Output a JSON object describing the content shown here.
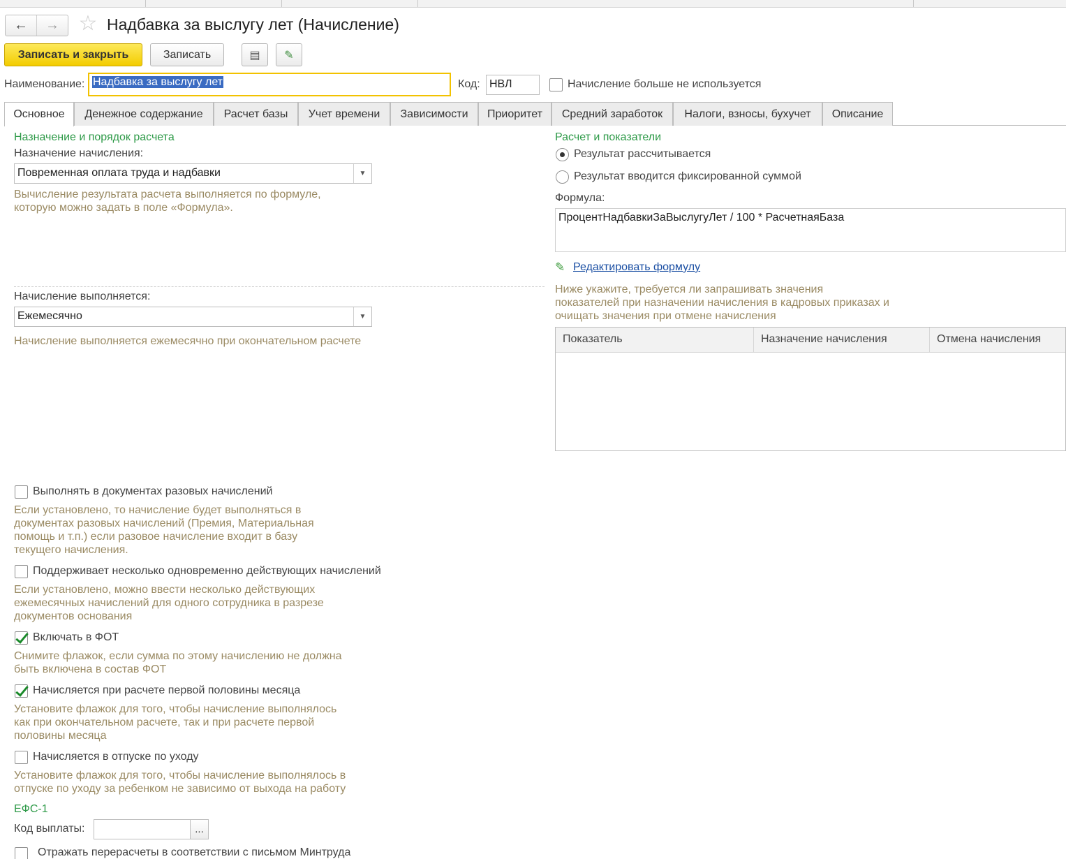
{
  "window": {
    "title": "Надбавка за выслугу лет (Начисление)",
    "back_glyph": "←",
    "forward_glyph": "→",
    "star_glyph": "☆"
  },
  "toolbar": {
    "save_close_label": "Записать и закрыть",
    "save_label": "Записать",
    "report_glyph": "▤",
    "edit_glyph": "✎"
  },
  "header": {
    "name_label": "Наименование:",
    "name_value": "Надбавка за выслугу лет",
    "code_label": "Код:",
    "code_value": "НВЛ",
    "unused_label": "Начисление больше не используется",
    "unused_checked": false
  },
  "tabs": [
    {
      "label": "Основное",
      "active": true
    },
    {
      "label": "Денежное содержание"
    },
    {
      "label": "Расчет базы"
    },
    {
      "label": "Учет времени"
    },
    {
      "label": "Зависимости"
    },
    {
      "label": "Приоритет"
    },
    {
      "label": "Средний заработок"
    },
    {
      "label": "Налоги, взносы, бухучет"
    },
    {
      "label": "Описание"
    }
  ],
  "left": {
    "section_title": "Назначение и порядок расчета",
    "purpose_label": "Назначение начисления:",
    "purpose_value": "Повременная оплата труда и надбавки",
    "purpose_hint_1": "Вычисление результата расчета выполняется по формуле,",
    "purpose_hint_2": "которую можно задать в поле «Формула».",
    "period_label": "Начисление выполняется:",
    "period_value": "Ежемесячно",
    "period_hint": "Начисление выполняется ежемесячно при окончательном расчете",
    "options": [
      {
        "label": "Выполнять в документах разовых начислений",
        "checked": false,
        "hint": [
          "Если установлено, то начисление будет выполняться в",
          "документах разовых начислений (Премия, Материальная",
          "помощь и т.п.) если разовое начисление входит в базу",
          "текущего начисления."
        ]
      },
      {
        "label": "Поддерживает несколько одновременно действующих начислений",
        "checked": false,
        "hint": [
          "Если установлено, можно ввести несколько действующих",
          "ежемесячных начислений для одного сотрудника в разрезе",
          "документов основания"
        ]
      },
      {
        "label": "Включать в ФОТ",
        "checked": true,
        "hint": [
          "Снимите флажок, если сумма по этому начислению не должна",
          "быть включена в состав ФОТ"
        ]
      },
      {
        "label": "Начисляется при расчете первой половины месяца",
        "checked": true,
        "hint": [
          "Установите флажок для того, чтобы начисление выполнялось",
          "как при окончательном расчете, так и при расчете первой",
          "половины месяца"
        ]
      },
      {
        "label": "Начисляется в отпуске по уходу",
        "checked": false,
        "hint": [
          "Установите флажок для того, чтобы начисление выполнялось в",
          "отпуске по уходу за ребенком не зависимо от выхода на работу"
        ]
      }
    ],
    "efs_title": "ЕФС-1",
    "payment_code_label": "Код выплаты:",
    "payment_code_value": "",
    "ellipsis": "...",
    "mintrud_label": "Отражать перерасчеты в соответствии с письмом Минтруда",
    "mintrud_checked": false
  },
  "right": {
    "section_title": "Расчет и показатели",
    "radio_calc_label": "Результат рассчитывается",
    "radio_fixed_label": "Результат вводится фиксированной суммой",
    "radio_selected": "calc",
    "formula_label": "Формула:",
    "formula_value": "ПроцентНадбавкиЗаВыслугуЛет / 100 * РасчетнаяБаза",
    "edit_formula_label": "Редактировать формулу",
    "indicators_hint_1": "Ниже укажите, требуется ли запрашивать значения",
    "indicators_hint_2": "показателей при назначении начисления в кадровых приказах и",
    "indicators_hint_3": "очищать значения при отмене начисления",
    "grid_columns": [
      "Показатель",
      "Назначение начисления",
      "Отмена начисления"
    ],
    "grid_rows": []
  },
  "colors": {
    "accent_yellow": "#f3cc00",
    "section_green": "#2e9a48",
    "hint_brown": "#9a8a63",
    "link_blue": "#1b4fa3",
    "selection_blue": "#3a6bc2"
  }
}
